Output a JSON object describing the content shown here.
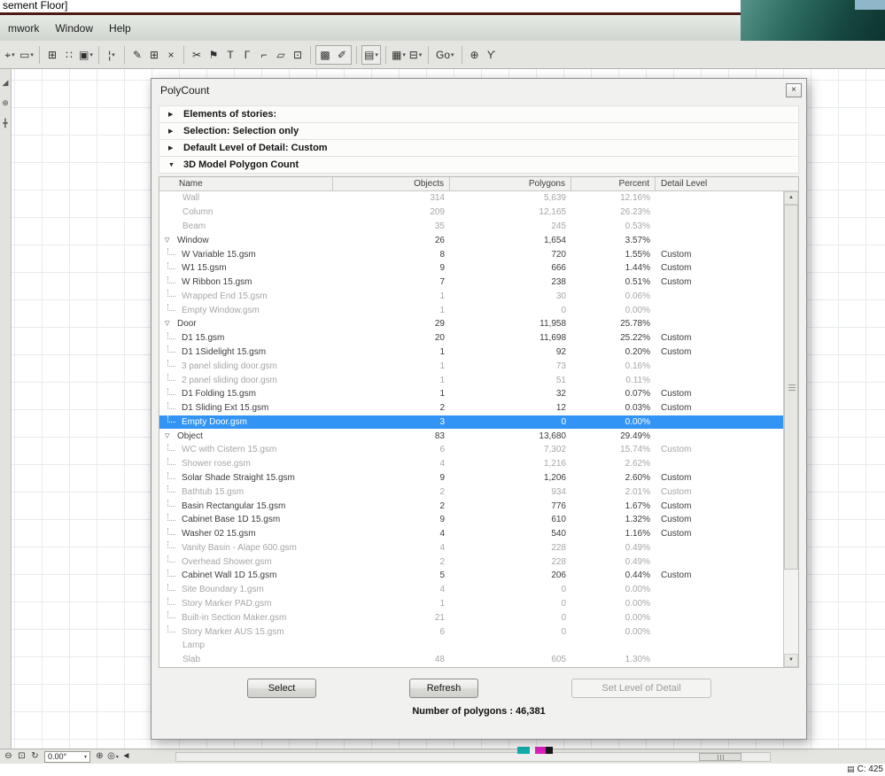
{
  "colors": {
    "selection_blue": "#3295f5",
    "title_red_line": "#4d1a14",
    "corner_teal": "#164740"
  },
  "icons": {
    "close": "×",
    "dropdown": "▾",
    "section_collapsed": "▶",
    "section_expanded": "▼",
    "tree_expanded": "▽",
    "scroll_up": "▲",
    "scroll_down": "▼"
  },
  "app": {
    "title_fragment": "sement Floor]",
    "menus": [
      {
        "label": "mwork"
      },
      {
        "label": "Window"
      },
      {
        "label": "Help"
      }
    ]
  },
  "toolbar": {
    "groups": [
      {
        "items": [
          {
            "name": "select-tool",
            "glyph": "⌖",
            "dropdown": true
          },
          {
            "name": "marquee-tool",
            "glyph": "▭",
            "dropdown": true
          }
        ]
      },
      {
        "items": [
          {
            "name": "snap-grid",
            "glyph": "⊞"
          },
          {
            "name": "snap-points",
            "glyph": "∷"
          },
          {
            "name": "fill-tool",
            "glyph": "▣",
            "dropdown": true
          }
        ]
      },
      {
        "items": [
          {
            "name": "line-weight",
            "glyph": "¦",
            "dropdown": true
          }
        ]
      },
      {
        "items": [
          {
            "name": "annotate-tool",
            "glyph": "✎"
          },
          {
            "name": "mesh-tool",
            "glyph": "⊞"
          },
          {
            "name": "delete-tool",
            "glyph": "×"
          }
        ]
      },
      {
        "items": [
          {
            "name": "split-tool",
            "glyph": "✂"
          },
          {
            "name": "flag-tool",
            "glyph": "⚑"
          },
          {
            "name": "adjust-tool",
            "glyph": "T"
          },
          {
            "name": "corner-tool",
            "glyph": "Γ"
          },
          {
            "name": "fillet-tool",
            "glyph": "⌐"
          },
          {
            "name": "stretch-tool",
            "glyph": "▱"
          },
          {
            "name": "copy-tool",
            "glyph": "⊡"
          }
        ]
      },
      {
        "boxed": true,
        "items": [
          {
            "name": "3d-window",
            "glyph": "▩"
          },
          {
            "name": "paint-tool",
            "glyph": "✐"
          }
        ]
      },
      {
        "boxed": true,
        "items": [
          {
            "name": "layout-window",
            "glyph": "▤",
            "dropdown": true
          }
        ]
      },
      {
        "items": [
          {
            "name": "image-view",
            "glyph": "▦",
            "dropdown": true
          },
          {
            "name": "section-view",
            "glyph": "⊟",
            "dropdown": true
          }
        ]
      },
      {
        "items": [
          {
            "name": "go-menu",
            "label": "Go",
            "dropdown": true
          }
        ]
      },
      {
        "items": [
          {
            "name": "comment-tool",
            "glyph": "⊕"
          },
          {
            "name": "walk-tool",
            "glyph": "ϒ"
          }
        ]
      }
    ]
  },
  "left_toolbar": {
    "icons": [
      {
        "name": "arrow-tool-icon",
        "glyph": "◢"
      },
      {
        "name": "zoom-tool-icon",
        "glyph": "⊕"
      },
      {
        "name": "hand-tool-icon",
        "glyph": "╋"
      }
    ]
  },
  "dialog": {
    "title": "PolyCount",
    "sections": [
      {
        "label": "Elements of stories:",
        "expanded": false
      },
      {
        "label": "Selection: Selection only",
        "expanded": false
      },
      {
        "label": "Default Level of Detail: Custom",
        "expanded": false
      },
      {
        "label": "3D Model Polygon Count",
        "expanded": true
      }
    ],
    "table": {
      "columns": [
        "Name",
        "Objects",
        "Polygons",
        "Percent",
        "Detail Level"
      ],
      "rows": [
        {
          "name": "Wall",
          "objects": "314",
          "polygons": "5,639",
          "percent": "12.16%",
          "detail": "",
          "level": 0,
          "group": false,
          "style": "gray"
        },
        {
          "name": "Column",
          "objects": "209",
          "polygons": "12,165",
          "percent": "26.23%",
          "detail": "",
          "level": 0,
          "group": false,
          "style": "gray"
        },
        {
          "name": "Beam",
          "objects": "35",
          "polygons": "245",
          "percent": "0.53%",
          "detail": "",
          "level": 0,
          "group": false,
          "style": "gray"
        },
        {
          "name": "Window",
          "objects": "26",
          "polygons": "1,654",
          "percent": "3.57%",
          "detail": "",
          "level": 0,
          "group": true,
          "style": ""
        },
        {
          "name": "W Variable 15.gsm",
          "objects": "8",
          "polygons": "720",
          "percent": "1.55%",
          "detail": "Custom",
          "level": 1,
          "group": false,
          "style": ""
        },
        {
          "name": "W1 15.gsm",
          "objects": "9",
          "polygons": "666",
          "percent": "1.44%",
          "detail": "Custom",
          "level": 1,
          "group": false,
          "style": ""
        },
        {
          "name": "W Ribbon 15.gsm",
          "objects": "7",
          "polygons": "238",
          "percent": "0.51%",
          "detail": "Custom",
          "level": 1,
          "group": false,
          "style": ""
        },
        {
          "name": "Wrapped End 15.gsm",
          "objects": "1",
          "polygons": "30",
          "percent": "0.06%",
          "detail": "",
          "level": 1,
          "group": false,
          "style": "gray"
        },
        {
          "name": "Empty Window.gsm",
          "objects": "1",
          "polygons": "0",
          "percent": "0.00%",
          "detail": "",
          "level": 1,
          "group": false,
          "style": "gray"
        },
        {
          "name": "Door",
          "objects": "29",
          "polygons": "11,958",
          "percent": "25.78%",
          "detail": "",
          "level": 0,
          "group": true,
          "style": ""
        },
        {
          "name": "D1 15.gsm",
          "objects": "20",
          "polygons": "11,698",
          "percent": "25.22%",
          "detail": "Custom",
          "level": 1,
          "group": false,
          "style": ""
        },
        {
          "name": "D1 1Sidelight 15.gsm",
          "objects": "1",
          "polygons": "92",
          "percent": "0.20%",
          "detail": "Custom",
          "level": 1,
          "group": false,
          "style": ""
        },
        {
          "name": "3 panel sliding door.gsm",
          "objects": "1",
          "polygons": "73",
          "percent": "0.16%",
          "detail": "",
          "level": 1,
          "group": false,
          "style": "gray"
        },
        {
          "name": "2 panel sliding door.gsm",
          "objects": "1",
          "polygons": "51",
          "percent": "0.11%",
          "detail": "",
          "level": 1,
          "group": false,
          "style": "gray"
        },
        {
          "name": "D1 Folding 15.gsm",
          "objects": "1",
          "polygons": "32",
          "percent": "0.07%",
          "detail": "Custom",
          "level": 1,
          "group": false,
          "style": ""
        },
        {
          "name": "D1 Sliding Ext 15.gsm",
          "objects": "2",
          "polygons": "12",
          "percent": "0.03%",
          "detail": "Custom",
          "level": 1,
          "group": false,
          "style": ""
        },
        {
          "name": "Empty Door.gsm",
          "objects": "3",
          "polygons": "0",
          "percent": "0.00%",
          "detail": "",
          "level": 1,
          "group": false,
          "style": "selected"
        },
        {
          "name": "Object",
          "objects": "83",
          "polygons": "13,680",
          "percent": "29.49%",
          "detail": "",
          "level": 0,
          "group": true,
          "style": ""
        },
        {
          "name": "WC with Cistern 15.gsm",
          "objects": "6",
          "polygons": "7,302",
          "percent": "15.74%",
          "detail": "Custom",
          "level": 1,
          "group": false,
          "style": "gray"
        },
        {
          "name": "Shower rose.gsm",
          "objects": "4",
          "polygons": "1,216",
          "percent": "2.62%",
          "detail": "",
          "level": 1,
          "group": false,
          "style": "gray"
        },
        {
          "name": "Solar Shade Straight 15.gsm",
          "objects": "9",
          "polygons": "1,206",
          "percent": "2.60%",
          "detail": "Custom",
          "level": 1,
          "group": false,
          "style": ""
        },
        {
          "name": "Bathtub 15.gsm",
          "objects": "2",
          "polygons": "934",
          "percent": "2.01%",
          "detail": "Custom",
          "level": 1,
          "group": false,
          "style": "gray"
        },
        {
          "name": "Basin Rectangular 15.gsm",
          "objects": "2",
          "polygons": "776",
          "percent": "1.67%",
          "detail": "Custom",
          "level": 1,
          "group": false,
          "style": ""
        },
        {
          "name": "Cabinet Base 1D 15.gsm",
          "objects": "9",
          "polygons": "610",
          "percent": "1.32%",
          "detail": "Custom",
          "level": 1,
          "group": false,
          "style": ""
        },
        {
          "name": "Washer 02 15.gsm",
          "objects": "4",
          "polygons": "540",
          "percent": "1.16%",
          "detail": "Custom",
          "level": 1,
          "group": false,
          "style": ""
        },
        {
          "name": "Vanity Basin - Alape 600.gsm",
          "objects": "4",
          "polygons": "228",
          "percent": "0.49%",
          "detail": "",
          "level": 1,
          "group": false,
          "style": "gray"
        },
        {
          "name": "Overhead Shower.gsm",
          "objects": "2",
          "polygons": "228",
          "percent": "0.49%",
          "detail": "",
          "level": 1,
          "group": false,
          "style": "gray"
        },
        {
          "name": "Cabinet Wall 1D 15.gsm",
          "objects": "5",
          "polygons": "206",
          "percent": "0.44%",
          "detail": "Custom",
          "level": 1,
          "group": false,
          "style": ""
        },
        {
          "name": "Site Boundary 1.gsm",
          "objects": "4",
          "polygons": "0",
          "percent": "0.00%",
          "detail": "",
          "level": 1,
          "group": false,
          "style": "gray"
        },
        {
          "name": "Story Marker PAD.gsm",
          "objects": "1",
          "polygons": "0",
          "percent": "0.00%",
          "detail": "",
          "level": 1,
          "group": false,
          "style": "gray"
        },
        {
          "name": "Built-in Section Maker.gsm",
          "objects": "21",
          "polygons": "0",
          "percent": "0.00%",
          "detail": "",
          "level": 1,
          "group": false,
          "style": "gray"
        },
        {
          "name": "Story Marker AUS 15.gsm",
          "objects": "6",
          "polygons": "0",
          "percent": "0.00%",
          "detail": "",
          "level": 1,
          "group": false,
          "style": "gray"
        },
        {
          "name": "Lamp",
          "objects": "",
          "polygons": "",
          "percent": "",
          "detail": "",
          "level": 0,
          "group": false,
          "style": "gray"
        },
        {
          "name": "Slab",
          "objects": "48",
          "polygons": "605",
          "percent": "1.30%",
          "detail": "",
          "level": 0,
          "group": false,
          "style": "gray"
        }
      ]
    },
    "buttons": [
      {
        "label": "Select",
        "enabled": true
      },
      {
        "label": "Refresh",
        "enabled": true
      },
      {
        "label": "Set Level of Detail",
        "enabled": false
      }
    ],
    "summary": "Number of polygons : 46,381"
  },
  "statusbar": {
    "angle_value": "0.00°",
    "icons_left": [
      {
        "name": "zoom-out",
        "glyph": "⊖"
      },
      {
        "name": "zoom-fit",
        "glyph": "⊡"
      },
      {
        "name": "rotate-view",
        "glyph": "↻"
      }
    ],
    "icons_right": [
      {
        "name": "zoom-in",
        "glyph": "⊕"
      },
      {
        "name": "view-options",
        "glyph": "◎",
        "dropdown": true
      },
      {
        "name": "scroll-left",
        "glyph": "◄"
      }
    ]
  },
  "bottom": {
    "right_text": "C: 425"
  }
}
